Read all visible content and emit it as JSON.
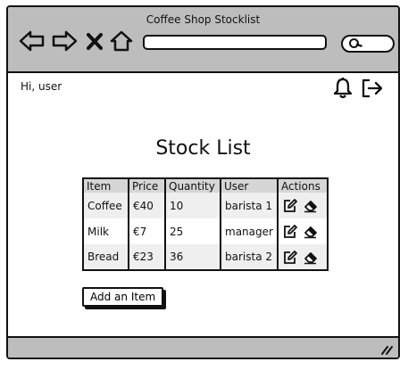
{
  "window": {
    "title": "Coffee Shop Stocklist"
  },
  "browser": {
    "icons": [
      "back-arrow-icon",
      "forward-arrow-icon",
      "close-icon",
      "home-icon",
      "search-icon"
    ]
  },
  "header": {
    "greeting": "Hi, user",
    "icons": [
      "bell-icon",
      "logout-icon"
    ]
  },
  "main": {
    "title": "Stock List",
    "table": {
      "columns": [
        "Item",
        "Price",
        "Quantity",
        "User",
        "Actions"
      ],
      "rows": [
        {
          "item": "Coffee",
          "price": "€40",
          "quantity": "10",
          "user": "barista 1"
        },
        {
          "item": "Milk",
          "price": "€7",
          "quantity": "25",
          "user": "manager"
        },
        {
          "item": "Bread",
          "price": "€23",
          "quantity": "36",
          "user": "barista 2"
        }
      ],
      "action_icons": [
        "edit-icon",
        "eraser-icon"
      ]
    },
    "add_button_label": "Add an Item"
  },
  "colors": {
    "chrome": "#bdbdbd",
    "header_row": "#d6d6d6",
    "row_stripe": "#efefef",
    "ink": "#111111"
  }
}
